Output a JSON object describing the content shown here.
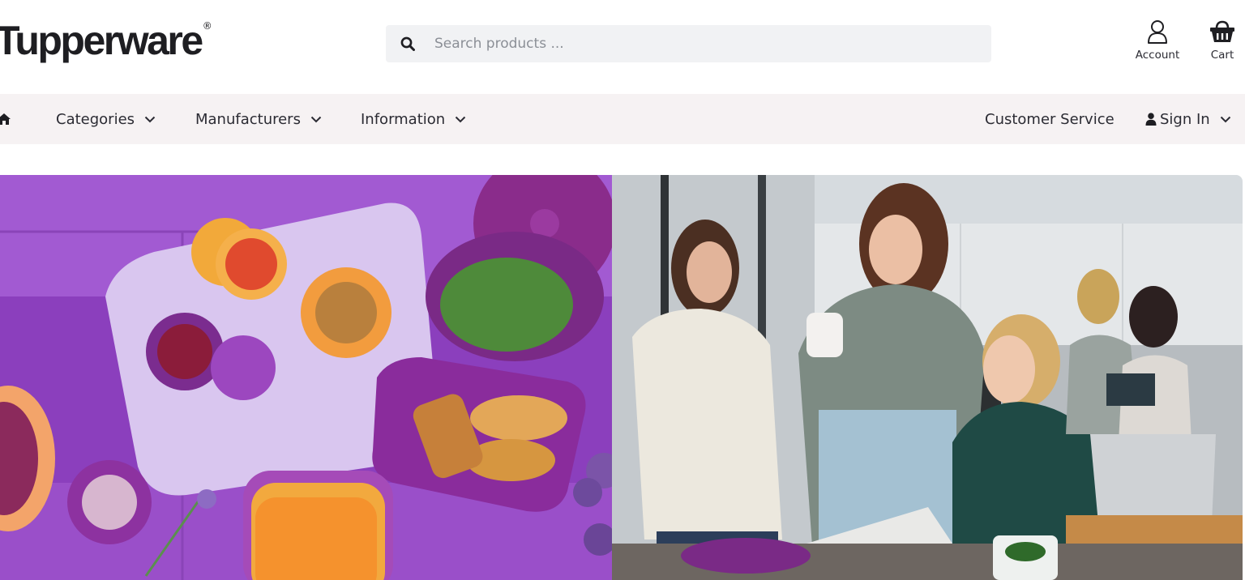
{
  "brand": {
    "name": "Tupperware",
    "mark": "®"
  },
  "search": {
    "placeholder": "Search products ..."
  },
  "header_actions": {
    "account_label": "Account",
    "cart_label": "Cart"
  },
  "nav": {
    "categories": "Categories",
    "manufacturers": "Manufacturers",
    "information": "Information",
    "customer_service": "Customer Service",
    "sign_in": "Sign In"
  },
  "icons": {
    "home": "home-icon",
    "search": "search-icon",
    "account": "user-outline-icon",
    "cart": "basket-icon",
    "chevron": "chevron-down-icon",
    "user": "user-icon"
  },
  "colors": {
    "nav_background": "#f6f2f3",
    "search_background": "#f1f2f4",
    "text": "#2b2b33",
    "hero_purple": "#9a4fc9"
  }
}
